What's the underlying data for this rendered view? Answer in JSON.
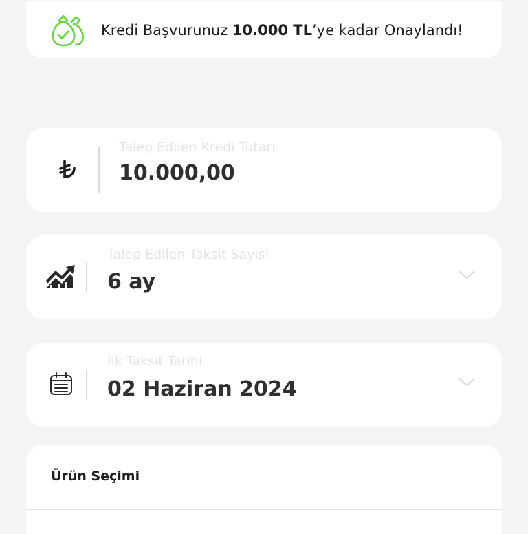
{
  "banner": {
    "text_before": "Kredi Başvurunuz ",
    "amount": "10.000 TL",
    "text_after": "’ye kadar Onaylandı!",
    "icon": "money-bag-check-icon",
    "accent_color": "#5fd93a"
  },
  "fields": {
    "amount": {
      "label": "Talep Edilen Kredi Tutarı",
      "value": "10.000,00",
      "icon": "turkish-lira-icon"
    },
    "installment_count": {
      "label": "Talep Edilen Taksit Sayısı",
      "value": "6 ay",
      "icon": "trend-chart-icon"
    },
    "first_installment_date": {
      "label": "İlk Taksit Tarihi",
      "value": "02 Haziran 2024",
      "icon": "calendar-icon"
    }
  },
  "product": {
    "title": "Ürün Seçimi"
  }
}
